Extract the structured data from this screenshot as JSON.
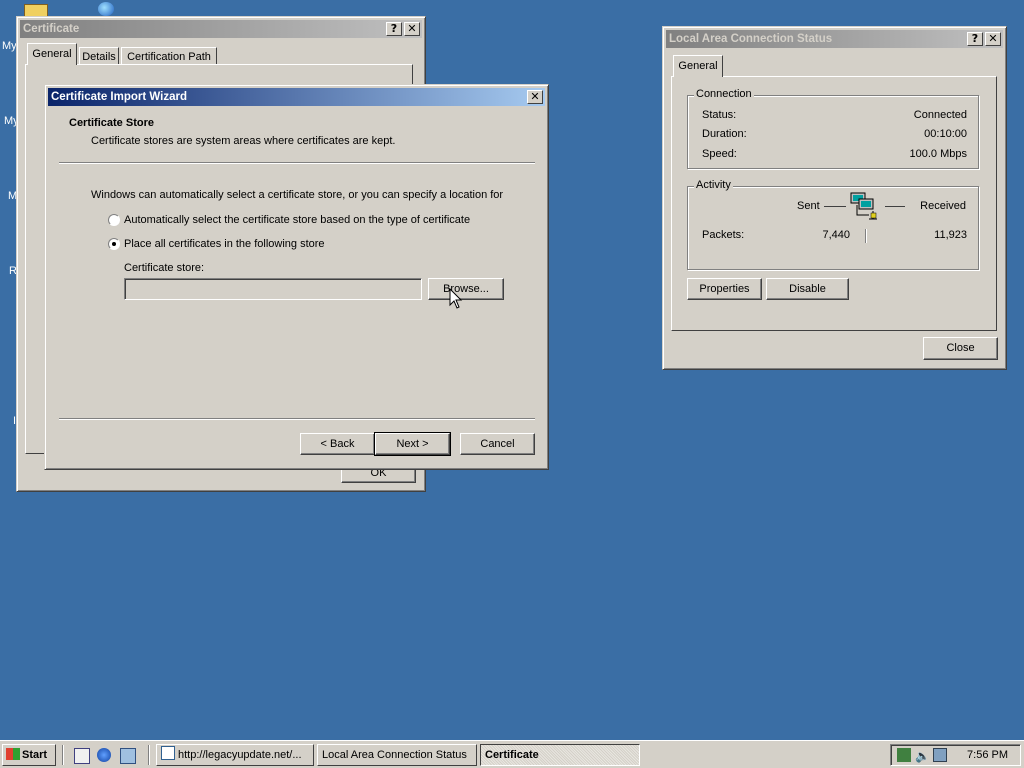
{
  "desktop": {
    "labels": [
      "My",
      "My",
      "M",
      "R",
      "I"
    ]
  },
  "cert_window": {
    "title": "Certificate",
    "tabs": [
      "General",
      "Details",
      "Certification Path"
    ],
    "ok_label": "OK",
    "help": "?",
    "close": "✕"
  },
  "wizard": {
    "title": "Certificate Import Wizard",
    "close": "✕",
    "heading": "Certificate Store",
    "subheading": "Certificate stores are system areas where certificates are kept.",
    "intro": "Windows can automatically select a certificate store, or you can specify a location for",
    "option_auto": "Automatically select the certificate store based on the type of certificate",
    "option_manual": "Place all certificates in the following store",
    "selected_option": "manual",
    "store_label": "Certificate store:",
    "store_value": "",
    "browse_label": "Browse...",
    "back_label": "< Back",
    "next_label": "Next >",
    "cancel_label": "Cancel"
  },
  "lan_status": {
    "title": "Local Area Connection Status",
    "help": "?",
    "close": "✕",
    "tab": "General",
    "connection": {
      "group_label": "Connection",
      "status_label": "Status:",
      "status_value": "Connected",
      "duration_label": "Duration:",
      "duration_value": "00:10:00",
      "speed_label": "Speed:",
      "speed_value": "100.0 Mbps"
    },
    "activity": {
      "group_label": "Activity",
      "sent_label": "Sent",
      "received_label": "Received",
      "packets_label": "Packets:",
      "packets_sent": "7,440",
      "packets_received": "11,923"
    },
    "properties_label": "Properties",
    "disable_label": "Disable",
    "close_label": "Close"
  },
  "taskbar": {
    "start_label": "Start",
    "tasks": [
      {
        "label": "http://legacyupdate.net/...",
        "pressed": false
      },
      {
        "label": "Local Area Connection Status",
        "pressed": false
      },
      {
        "label": "Certificate",
        "pressed": true
      }
    ],
    "clock": "7:56 PM"
  },
  "colors": {
    "desktop": "#3a6ea5",
    "active_title": "#0a246a",
    "face": "#d4d0c8"
  }
}
